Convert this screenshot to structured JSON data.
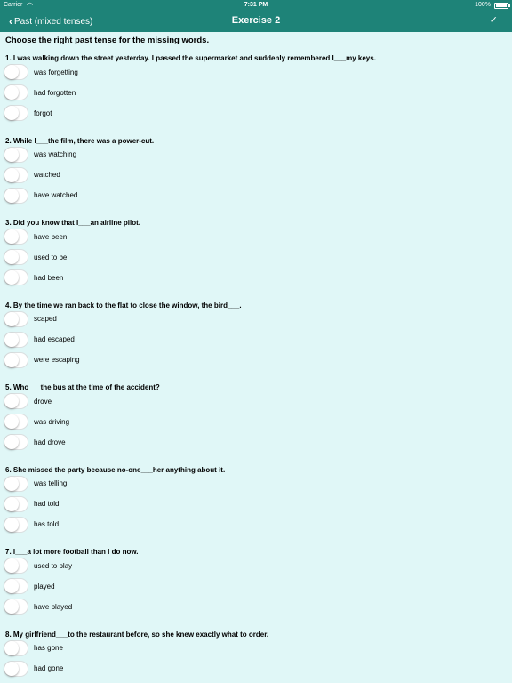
{
  "status": {
    "carrier": "Carrier",
    "time": "7:31 PM",
    "battery": "100%"
  },
  "nav": {
    "back_label": "Past (mixed tenses)",
    "title": "Exercise 2",
    "done_icon": "checkmark-icon"
  },
  "instruction": "Choose the right past tense for the missing words.",
  "questions": [
    {
      "text": "1. I was walking down the street yesterday. I passed the supermarket and suddenly remembered I___my keys.",
      "options": [
        "was forgetting",
        "had forgotten",
        "forgot"
      ]
    },
    {
      "text": "2. While I___the film, there was a power-cut.",
      "options": [
        "was watching",
        "watched",
        "have watched"
      ]
    },
    {
      "text": "3. Did you know that I___an airline pilot.",
      "options": [
        "have been",
        "used to be",
        "had been"
      ]
    },
    {
      "text": "4. By the time we ran back to the flat to close the window, the bird___.",
      "options": [
        "scaped",
        "had escaped",
        "were escaping"
      ]
    },
    {
      "text": "5. Who___the bus at the time of the accident?",
      "options": [
        "drove",
        "was driving",
        "had drove"
      ]
    },
    {
      "text": "6. She missed the party because no-one___her anything about it.",
      "options": [
        "was telling",
        "had told",
        "has told"
      ]
    },
    {
      "text": "7. I___a lot more football than I do now.",
      "options": [
        "used to play",
        "played",
        "have played"
      ]
    },
    {
      "text": "8. My girlfriend___to the restaurant before, so she knew exactly what to order.",
      "options": [
        "has gone",
        "had gone"
      ]
    }
  ]
}
